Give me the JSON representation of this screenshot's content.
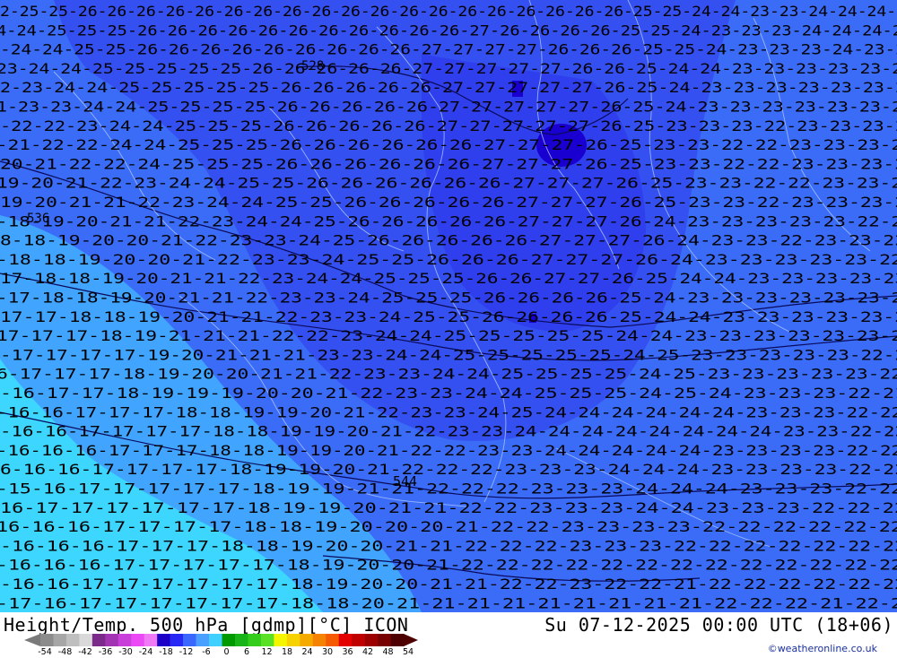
{
  "map": {
    "title": "Height/Temp. 500 hPa [gdmp][°C] ICON",
    "valid_time": "Su 07-12-2025 00:00 UTC (18+06)",
    "credit": "©weatheronline.co.uk",
    "low_marker": "544",
    "place_markers": [
      "528",
      "536"
    ],
    "isotherm_rows": [
      {
        "text": "2-25-25-26-26-26-26-26-26-26-26-26-26-26-26-26-26-26-26-26-26-26-25-25-24-24-23-23-24-24-24-2"
      },
      {
        "text": "4-24-25-25-25-26-26-26-26-26-26-26-26-26-26-26-27-26-26-26-26-25-25-24-23-23-23-24-24-24-2"
      },
      {
        "text": "-24-24-25-25-26-26-26-26-26-26-26-26-26-27-27-27-27-26-26-26-25-25-24-23-23-23-24-23-2"
      },
      {
        "text": "23-24-24-25-25-25-25-25-26-26-26-26-26-27-27-27-27-27-26-26-25-24-24-23-23-23-23-23-2"
      },
      {
        "text": "2-23-24-24-25-25-25-25-25-26-26-26-26-26-27-27-27-27-27-26-25-24-23-23-23-23-23-23-2"
      },
      {
        "text": "1-23-23-24-24-25-25-25-25-26-26-26-26-26-27-27-27-27-27-26-25-24-23-23-23-23-23-23-2"
      },
      {
        "text": "-22-22-23-24-24-25-25-25-26-26-26-26-26-27-27-27-27-27-26-25-23-23-23-22-23-23-23-2"
      },
      {
        "text": "-21-22-22-24-24-25-25-25-26-26-26-26-26-26-27-27-27-26-25-23-23-22-22-23-23-23-2"
      },
      {
        "text": "20-21-22-22-24-25-25-25-26-26-26-26-26-26-27-27-27-26-25-23-23-22-22-23-23-23-2"
      },
      {
        "text": "19-20-21-22-23-24-24-25-25-26-26-26-26-26-26-27-27-27-26-25-23-23-22-22-23-23-2"
      },
      {
        "text": "19-20-21-21-22-23-24-24-25-25-26-26-26-26-26-27-27-27-26-25-23-23-22-23-23-23-2"
      },
      {
        "text": "-18-19-20-21-21-22-23-24-24-25-26-26-26-26-26-27-27-27-26-24-23-23-23-23-23-22-2"
      },
      {
        "text": "8-18-19-20-20-21-22-23-23-24-25-26-26-26-26-26-27-27-27-26-24-23-23-22-23-23-22"
      },
      {
        "text": "-18-18-19-20-20-21-22-23-23-24-25-25-26-26-26-27-27-27-26-24-23-23-23-23-23-22"
      },
      {
        "text": "17-18-18-19-20-21-21-22-23-24-24-25-25-25-26-26-27-27-26-25-24-24-23-23-23-23-23"
      },
      {
        "text": "-17-18-18-19-20-21-21-22-23-23-24-25-25-25-26-26-26-26-25-24-23-23-23-23-23-23-2"
      },
      {
        "text": "17-17-18-18-19-20-21-21-22-23-23-24-25-25-26-26-26-26-25-24-24-23-23-23-23-23-2"
      },
      {
        "text": "17-17-17-18-19-21-21-21-22-22-23-24-24-25-25-25-25-25-24-24-23-23-23-23-23-23-2"
      },
      {
        "text": "-17-17-17-17-19-20-21-21-21-23-23-24-24-25-25-25-25-25-24-25-23-23-23-23-23-22-2"
      },
      {
        "text": "6-17-17-17-18-19-20-20-21-21-22-23-23-24-24-25-25-25-25-24-25-23-23-23-23-23-22"
      },
      {
        "text": "-16-17-17-18-19-19-19-20-20-21-22-23-23-24-24-25-25-25-24-25-24-23-23-23-22-21"
      },
      {
        "text": "-16-16-17-17-17-18-18-19-19-20-21-22-23-23-24-25-24-24-24-24-24-24-23-23-23-22-22"
      },
      {
        "text": "-16-16-17-17-17-17-18-18-19-19-20-21-22-23-23-24-24-24-24-24-24-24-24-23-23-22-22"
      },
      {
        "text": "-16-16-16-17-17-17-18-18-19-19-20-21-22-22-23-23-24-24-24-24-24-23-23-23-23-22-22"
      },
      {
        "text": "6-16-16-17-17-17-17-18-19-19-20-21-22-22-22-23-23-23-24-24-24-23-23-23-23-22-22"
      },
      {
        "text": "-15-16-17-17-17-17-17-18-19-19-21-21-22-22-22-23-23-23-24-24-24-23-23-23-22-22"
      },
      {
        "text": "16-17-17-17-17-17-17-18-19-19-20-21-21-22-22-23-23-23-24-24-23-23-23-22-22-22"
      },
      {
        "text": "16-16-16-17-17-17-17-18-18-19-20-20-20-21-22-22-23-23-23-23-22-22-22-22-22-22"
      },
      {
        "text": "-16-16-16-17-17-17-18-18-19-20-20-21-21-22-22-22-23-23-23-22-22-22-22-22-22-22"
      },
      {
        "text": "-16-16-16-17-17-17-17-17-18-19-20-20-21-22-22-22-22-22-22-22-22-22-22-22-22-22"
      },
      {
        "text": "-16-16-17-17-17-17-17-17-18-19-20-20-21-21-22-22-23-22-22-21-22-22-22-22-22-22"
      },
      {
        "text": "-17-16-17-17-17-17-17-17-18-18-20-21-21-21-21-21-21-21-21-21-22-22-22-21-22-2"
      }
    ],
    "colorbar": {
      "labels": [
        "-54",
        "-48",
        "-42",
        "-36",
        "-30",
        "-24",
        "-18",
        "-12",
        "-6",
        "0",
        "6",
        "12",
        "18",
        "24",
        "30",
        "36",
        "42",
        "48",
        "54"
      ],
      "colors": [
        "#8c8c8c",
        "#a6a6a6",
        "#bfbfbf",
        "#d9d9d9",
        "#7b2a8c",
        "#a233b3",
        "#c93fd9",
        "#ea49f5",
        "#f079f5",
        "#1d00c8",
        "#2828f5",
        "#3a68ff",
        "#4aa0ff",
        "#40d0ff",
        "#009a00",
        "#18b418",
        "#34cc1a",
        "#5ae024",
        "#f5f500",
        "#f5d200",
        "#f5aa00",
        "#f58200",
        "#f55a00",
        "#e40000",
        "#c00000",
        "#9c0000",
        "#780000",
        "#4e0000"
      ]
    }
  }
}
